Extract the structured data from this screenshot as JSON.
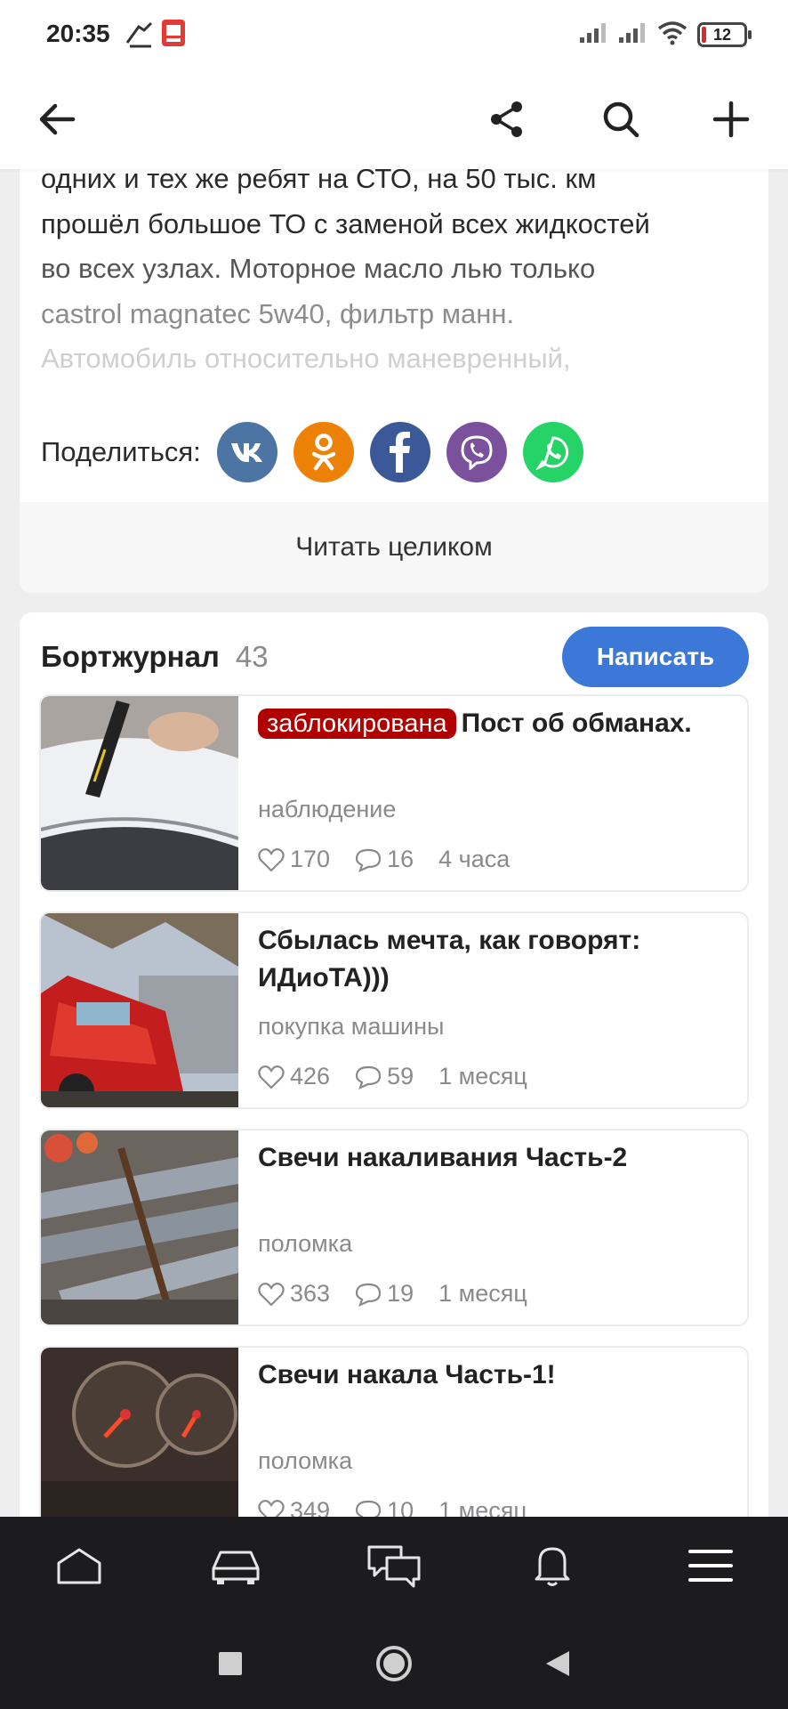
{
  "status_bar": {
    "time": "20:35",
    "battery": "12"
  },
  "article": {
    "lines": [
      "одних и тех же ребят на СТО, на 50 тыс. км",
      "прошёл большое ТО с заменой всех жидкостей",
      "во всех узлах. Моторное масло лью только",
      "castrol magnatec 5w40, фильтр манн.",
      "Автомобиль относительно маневренный,"
    ],
    "share_label": "Поделиться:",
    "share_services": [
      "vk-icon",
      "odnoklassniki-icon",
      "facebook-icon",
      "viber-icon",
      "whatsapp-icon"
    ],
    "read_full_label": "Читать целиком"
  },
  "logbook": {
    "title": "Бортжурнал",
    "count": "43",
    "write_label": "Написать",
    "posts": [
      {
        "badge": "заблокирована",
        "title": "Пост об обманах.",
        "tag": "наблюдение",
        "likes": "170",
        "comments": "16",
        "time": "4 часа"
      },
      {
        "badge": "",
        "title": "Сбылась мечта, как говорят: ИДиоТА)))",
        "tag": "покупка машины",
        "likes": "426",
        "comments": "59",
        "time": "1 месяц"
      },
      {
        "badge": "",
        "title": "Свечи накаливания Часть-2",
        "tag": "поломка",
        "likes": "363",
        "comments": "19",
        "time": "1 месяц"
      },
      {
        "badge": "",
        "title": "Свечи накала Часть-1!",
        "tag": "поломка",
        "likes": "349",
        "comments": "10",
        "time": "1 месяц"
      }
    ]
  },
  "colors": {
    "accent": "#3c78d8",
    "badge": "#b10000",
    "vk": "#4c75a3",
    "ok": "#ee8208",
    "facebook": "#3b5998",
    "viber": "#7b519d",
    "whatsapp": "#25d366"
  }
}
